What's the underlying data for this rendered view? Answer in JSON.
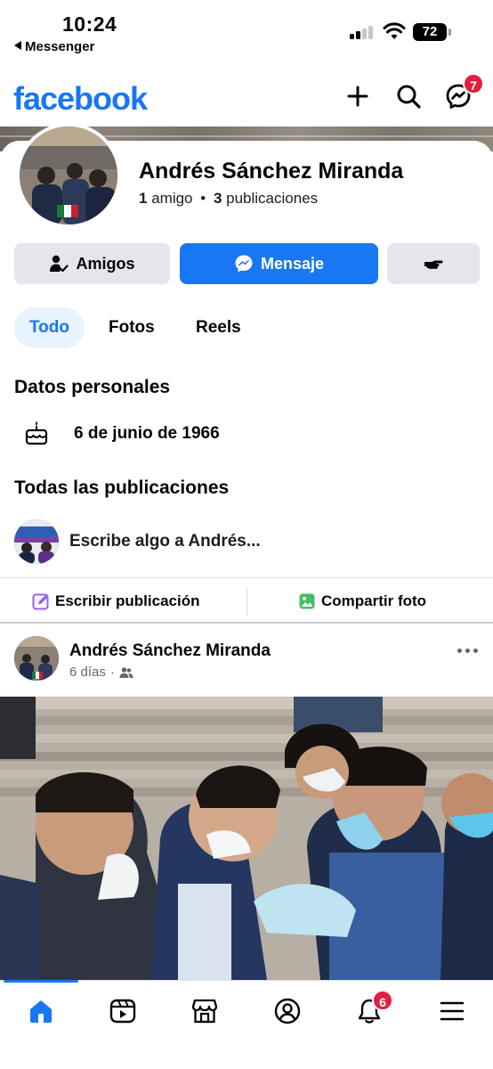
{
  "status_bar": {
    "time": "10:24",
    "back_app": "Messenger",
    "battery": "72"
  },
  "header": {
    "logo": "facebook",
    "messenger_badge": "7",
    "icons": [
      "plus-icon",
      "search-icon",
      "messenger-icon"
    ]
  },
  "profile": {
    "name": "Andrés Sánchez Miranda",
    "friends_count": "1",
    "friends_label": "amigo",
    "separator": "•",
    "posts_count": "3",
    "posts_label": "publicaciones"
  },
  "buttons": {
    "friends": "Amigos",
    "message": "Mensaje"
  },
  "tabs": [
    {
      "label": "Todo",
      "active": true
    },
    {
      "label": "Fotos",
      "active": false
    },
    {
      "label": "Reels",
      "active": false
    }
  ],
  "personal": {
    "title": "Datos personales",
    "birthday": "6 de junio de 1966"
  },
  "posts_section": {
    "title": "Todas las publicaciones",
    "composer_placeholder": "Escribe algo a Andrés...",
    "write_post": "Escribir publicación",
    "share_photo": "Compartir foto"
  },
  "post": {
    "author": "Andrés Sánchez Miranda",
    "time": "6 días",
    "separator": "·"
  },
  "bottom_nav": {
    "items": [
      "home-icon",
      "video-icon",
      "marketplace-icon",
      "profile-icon",
      "notifications-icon",
      "menu-icon"
    ],
    "notifications_badge": "6"
  },
  "colors": {
    "brand": "#1877f2",
    "badge": "#e41e3f",
    "button_gray": "#e4e6eb",
    "tab_active_bg": "#e7f3ff"
  }
}
